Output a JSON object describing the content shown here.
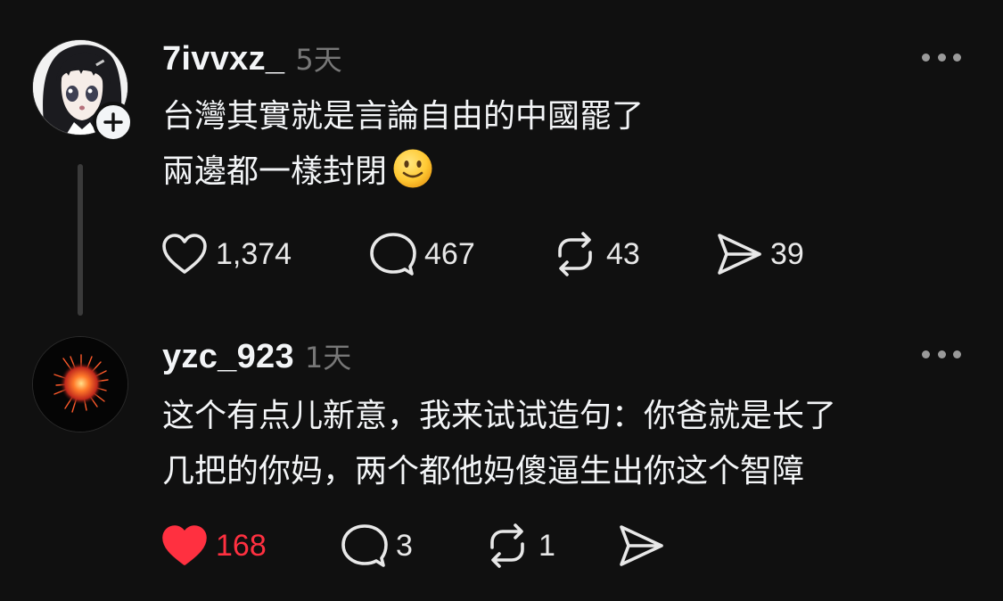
{
  "posts": [
    {
      "username": "7ivvxz_",
      "time": "5天",
      "text_lines": [
        "台灣其實就是言論自由的中國罷了",
        "兩邊都一樣封閉"
      ],
      "emoji": "slightly-smiling-face",
      "stats": {
        "likes": "1,374",
        "replies": "467",
        "reposts": "43",
        "shares": "39"
      },
      "liked": false,
      "avatar": "anime-girl-avatar",
      "show_follow_badge": true
    },
    {
      "username": "yzc_923",
      "time": "1天",
      "text_lines": [
        "这个有点儿新意，我来试试造句：你爸就是长了",
        "几把的你妈，两个都他妈傻逼生出你这个智障"
      ],
      "stats": {
        "likes": "168",
        "replies": "3",
        "reposts": "1",
        "shares": ""
      },
      "liked": true,
      "avatar": "fireworks-avatar",
      "show_follow_badge": false
    }
  ],
  "colors": {
    "background": "#101010",
    "text_primary": "#f3f5f7",
    "text_secondary": "#777777",
    "like_active": "#ff3040",
    "thread_line": "#3a3a3a"
  },
  "icons": [
    "heart-icon",
    "reply-bubble-icon",
    "repost-icon",
    "share-send-icon",
    "more-dots-icon",
    "plus-icon"
  ]
}
